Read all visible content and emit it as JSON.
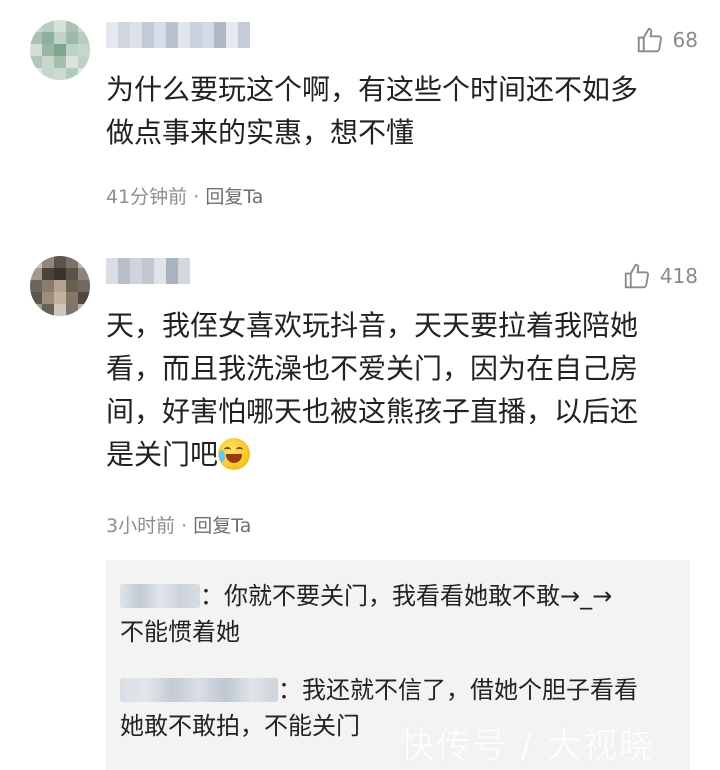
{
  "comments": [
    {
      "likes": "68",
      "text_lines": [
        "为什么要玩这个啊，有这些个时间还不如多",
        "做点事来的实惠，想不懂"
      ],
      "time": "41分钟前",
      "separator": "·",
      "reply": "回复Ta"
    },
    {
      "likes": "418",
      "text_lines": [
        "天，我侄女喜欢玩抖音，天天要拉着我陪她",
        "看，而且我洗澡也不爱关门，因为在自己房",
        "间，好害怕哪天也被这熊孩子直播，以后还",
        "是关门吧"
      ],
      "emoji": "laughing-tears-emoji",
      "time": "3小时前",
      "separator": "·",
      "reply": "回复Ta"
    }
  ],
  "sub_replies": [
    {
      "text_line1": "：你就不要关门，我看看她敢不敢→_→",
      "text_line2": "不能惯着她"
    },
    {
      "text_line1": "：我还就不信了，借她个胆子看看",
      "text_line2": "她敢不敢拍，不能关门"
    }
  ],
  "watermark": "快传号 / 大视晓",
  "colors": {
    "text": "#222222",
    "meta": "#8e8e8e",
    "reply_box": "#f3f3f3"
  },
  "icons": [
    "thumbs-up-icon"
  ]
}
